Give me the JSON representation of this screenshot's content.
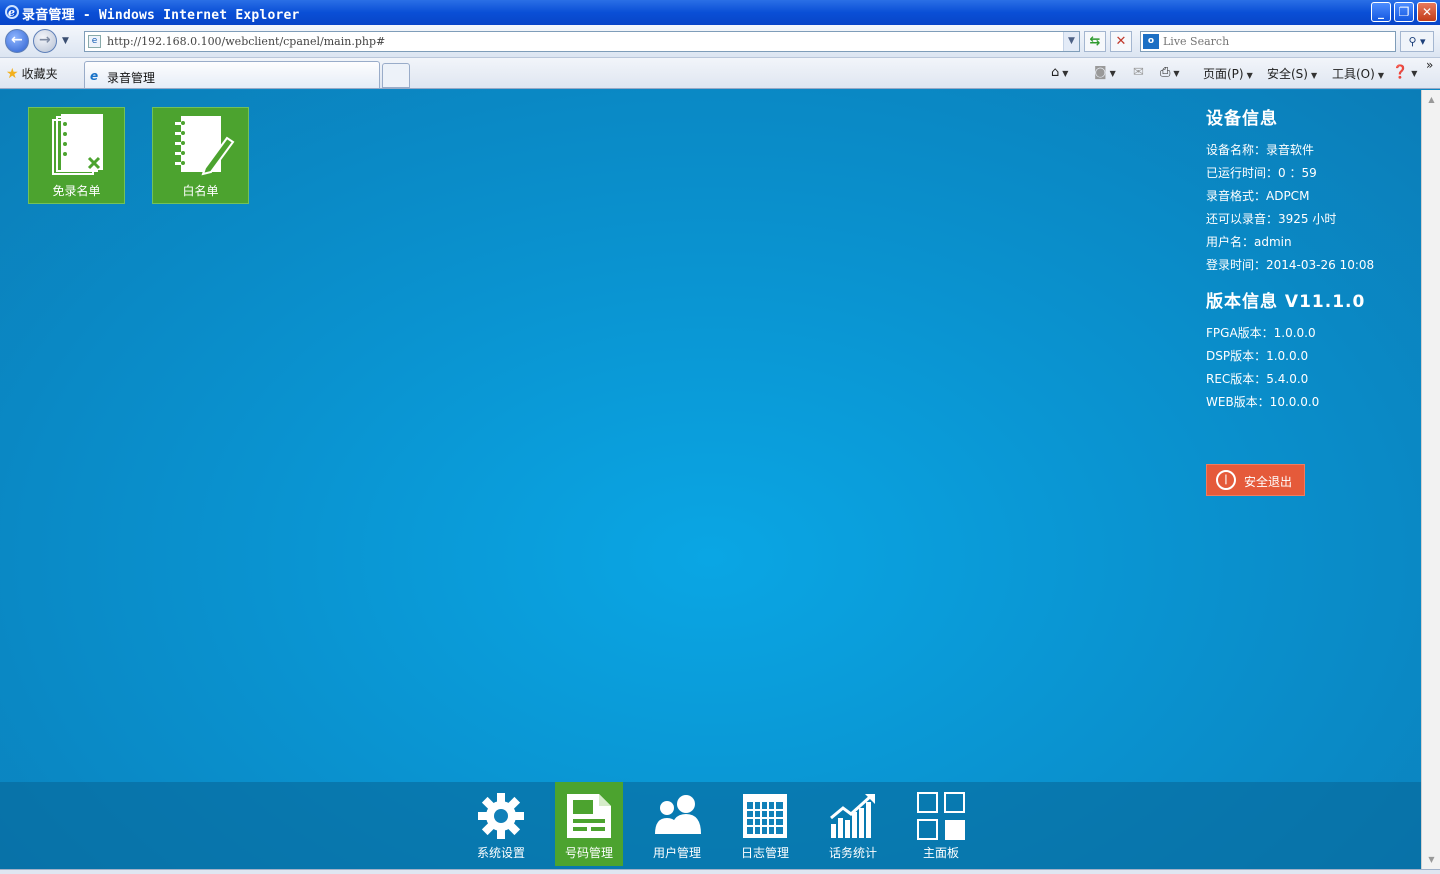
{
  "window": {
    "title": "录音管理 - Windows Internet Explorer",
    "controls": [
      "minimize",
      "maximize",
      "close"
    ]
  },
  "address_bar": {
    "url": "http://192.168.0.100/webclient/cpanel/main.php#",
    "search_placeholder": "Live Search"
  },
  "favorites": {
    "label": "收藏夹"
  },
  "tab": {
    "label": "录音管理"
  },
  "command_bar": {
    "page_label": "页面(P)",
    "safety_label": "安全(S)",
    "tools_label": "工具(O)"
  },
  "tiles": [
    {
      "label": "免录名单",
      "icon": "notebook-x-icon"
    },
    {
      "label": "白名单",
      "icon": "notebook-pencil-icon"
    }
  ],
  "device_info": {
    "heading": "设备信息",
    "device_name": "设备名称：录音软件",
    "uptime": "已运行时间：0 ：59",
    "format": "录音格式：ADPCM",
    "remaining": "还可以录音：3925 小时",
    "username": "用户名：admin",
    "login_time": "登录时间：2014-03-26 10:08"
  },
  "version_info": {
    "heading": "版本信息 V11.1.0",
    "fpga": "FPGA版本：1.0.0.0",
    "dsp": "DSP版本：1.0.0.0",
    "rec": "REC版本：5.4.0.0",
    "web": "WEB版本：10.0.0.0"
  },
  "logout": {
    "label": "安全退出"
  },
  "dock": {
    "items": [
      {
        "label": "系统设置",
        "icon": "gear-icon",
        "active": false
      },
      {
        "label": "号码管理",
        "icon": "document-icon",
        "active": true
      },
      {
        "label": "用户管理",
        "icon": "users-icon",
        "active": false
      },
      {
        "label": "日志管理",
        "icon": "calendar-icon",
        "active": false
      },
      {
        "label": "话务统计",
        "icon": "bar-chart-icon",
        "active": false
      },
      {
        "label": "主面板",
        "icon": "grid-icon",
        "active": false
      }
    ]
  },
  "colors": {
    "background": "#0a93d0",
    "tile_green": "#4ca32f",
    "logout_red": "#e55a3a"
  }
}
